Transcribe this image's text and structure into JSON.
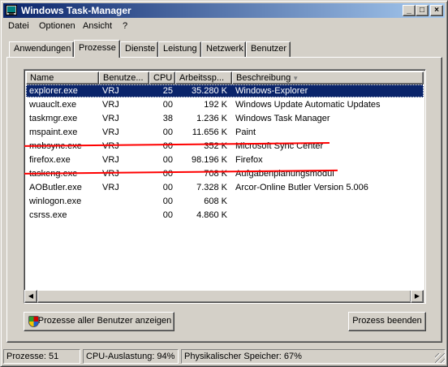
{
  "window": {
    "title": "Windows Task-Manager"
  },
  "title_buttons": {
    "minimize": "_",
    "maximize": "□",
    "close": "×"
  },
  "menu": [
    "Datei",
    "Optionen",
    "Ansicht",
    "?"
  ],
  "tabs": [
    "Anwendungen",
    "Prozesse",
    "Dienste",
    "Leistung",
    "Netzwerk",
    "Benutzer"
  ],
  "active_tab": "Prozesse",
  "columns": [
    "Name",
    "Benutze...",
    "CPU",
    "Arbeitssp...",
    "Beschreibung"
  ],
  "sort_column": "Beschreibung",
  "processes": [
    {
      "name": "explorer.exe",
      "user": "VRJ",
      "cpu": "25",
      "mem": "35.280 K",
      "desc": "Windows-Explorer",
      "selected": true,
      "struck": false
    },
    {
      "name": "wuauclt.exe",
      "user": "VRJ",
      "cpu": "00",
      "mem": "192 K",
      "desc": "Windows Update Automatic Updates",
      "selected": false,
      "struck": false
    },
    {
      "name": "taskmgr.exe",
      "user": "VRJ",
      "cpu": "38",
      "mem": "1.236 K",
      "desc": "Windows Task Manager",
      "selected": false,
      "struck": false
    },
    {
      "name": "mspaint.exe",
      "user": "VRJ",
      "cpu": "00",
      "mem": "11.656 K",
      "desc": "Paint",
      "selected": false,
      "struck": false
    },
    {
      "name": "mobsync.exe",
      "user": "VRJ",
      "cpu": "00",
      "mem": "352 K",
      "desc": "Microsoft Sync Center",
      "selected": false,
      "struck": true
    },
    {
      "name": "firefox.exe",
      "user": "VRJ",
      "cpu": "00",
      "mem": "98.196 K",
      "desc": "Firefox",
      "selected": false,
      "struck": false
    },
    {
      "name": "taskeng.exe",
      "user": "VRJ",
      "cpu": "00",
      "mem": "708 K",
      "desc": "Aufgabenplanungsmodul",
      "selected": false,
      "struck": true
    },
    {
      "name": "AOButler.exe",
      "user": "VRJ",
      "cpu": "00",
      "mem": "7.328 K",
      "desc": "Arcor-Online Butler Version 5.006",
      "selected": false,
      "struck": false
    },
    {
      "name": "winlogon.exe",
      "user": "",
      "cpu": "00",
      "mem": "608 K",
      "desc": "",
      "selected": false,
      "struck": false
    },
    {
      "name": "csrss.exe",
      "user": "",
      "cpu": "00",
      "mem": "4.860 K",
      "desc": "",
      "selected": false,
      "struck": false
    }
  ],
  "buttons": {
    "show_all": "Prozesse aller Benutzer anzeigen",
    "end_process": "Prozess beenden"
  },
  "status": {
    "processes": "Prozesse: 51",
    "cpu": "CPU-Auslastung: 94%",
    "memory": "Physikalischer Speicher: 67%"
  },
  "colors": {
    "title_start": "#0a246a",
    "title_end": "#a6caf0",
    "selection": "#0a246a",
    "strike": "#ff0000",
    "face": "#d4d0c8"
  }
}
